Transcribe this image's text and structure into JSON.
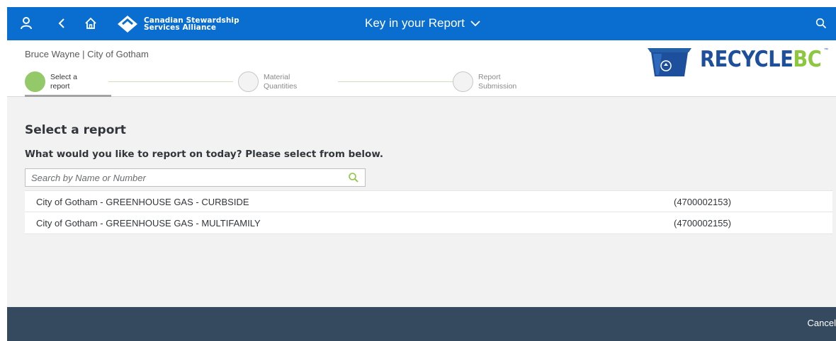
{
  "shellbar": {
    "logo_line1": "Canadian Stewardship",
    "logo_line2": "Services Alliance",
    "title": "Key in your Report",
    "icons": [
      "user-icon",
      "back-icon",
      "home-icon",
      "chevron-down-icon",
      "search-icon"
    ],
    "background": "#0a6ed1"
  },
  "header": {
    "user_line": "Bruce Wayne | City of Gotham",
    "brand_recycle": "RECYCLE",
    "brand_bc": "BC",
    "brand_tm": "™"
  },
  "wizard": {
    "steps": [
      {
        "label": "Select a report",
        "active": true
      },
      {
        "label": "Material Quantities",
        "active": false
      },
      {
        "label": "Report Submission",
        "active": false
      }
    ],
    "active_color": "#94c96a"
  },
  "content": {
    "title": "Select a report",
    "question": "What would you like to report on today? Please select from below.",
    "search_placeholder": "Search by Name or Number",
    "search_value": "",
    "reports": [
      {
        "name": "City of Gotham - GREENHOUSE GAS - CURBSIDE",
        "number": "(4700002153)"
      },
      {
        "name": "City of Gotham - GREENHOUSE GAS - MULTIFAMILY",
        "number": "(4700002155)"
      }
    ]
  },
  "footer": {
    "cancel_label": "Cancel",
    "background": "#354a5f"
  }
}
